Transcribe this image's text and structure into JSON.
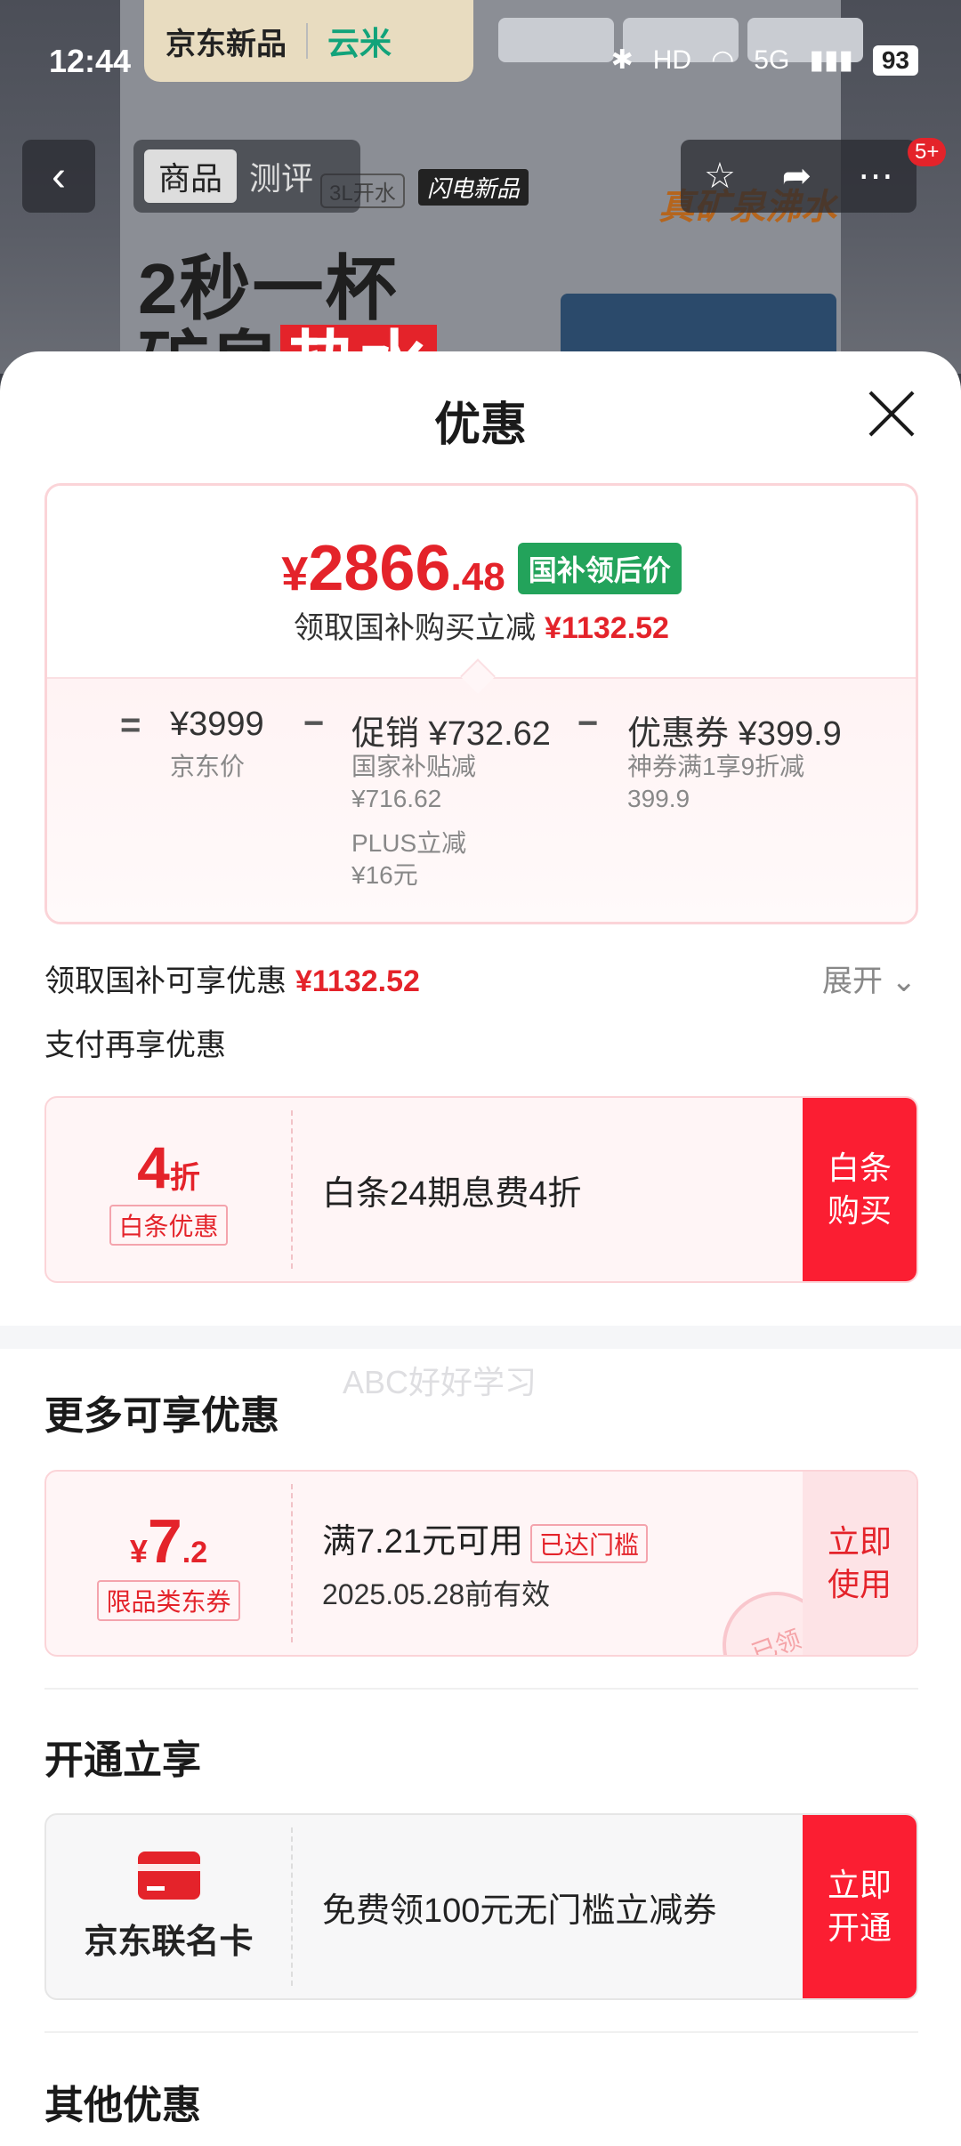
{
  "status_bar": {
    "time": "12:44",
    "battery": "93",
    "network": "5G"
  },
  "background": {
    "brand_jd": "京东新品",
    "brand_yunmi": "云米",
    "headline1": "2秒一杯",
    "headline2_a": "矿泉",
    "headline2_b": "热水",
    "sub_tag": "3L开水",
    "flash_tag": "闪电新品",
    "badge": "真矿泉沸水"
  },
  "nav": {
    "tab_product": "商品",
    "tab_review": "测评",
    "badge": "5+"
  },
  "sheet": {
    "title": "优惠",
    "summary": {
      "price_symbol": "¥",
      "price_int": "2866",
      "price_dec": ".48",
      "price_tag": "国补领后价",
      "save_text": "领取国补购买立减",
      "save_amount": "¥1132.52",
      "calc": {
        "eq": "=",
        "jd_price": "¥3999",
        "jd_price_label": "京东价",
        "minus1": "−",
        "promo": "促销 ¥732.62",
        "promo_sub1": "国家补贴减",
        "promo_sub1_val": "¥716.62",
        "promo_sub2": "PLUS立减",
        "promo_sub2_val": "¥16元",
        "minus2": "−",
        "coupon": "优惠券 ¥399.9",
        "coupon_sub": "神券满1享9折减",
        "coupon_sub_val": "399.9"
      }
    },
    "gov_row": {
      "label": "领取国补可享优惠",
      "amount": "¥1132.52",
      "expand": "展开"
    },
    "pay_row": {
      "label": "支付再享优惠"
    },
    "watermark": "ABC好好学习",
    "baitiao": {
      "discount_num": "4",
      "discount_unit": "折",
      "tag": "白条优惠",
      "main": "白条24期息费4折",
      "action_line1": "白条",
      "action_line2": "购买"
    },
    "more_section": "更多可享优惠",
    "coupon": {
      "symbol": "¥",
      "amount_int": "7",
      "amount_dec": ".2",
      "tag": "限品类东券",
      "main": "满7.21元可用",
      "reached": "已达门槛",
      "valid": "2025.05.28前有效",
      "stamp": "已领",
      "action_line1": "立即",
      "action_line2": "使用"
    },
    "open_section": "开通立享",
    "card": {
      "name": "京东联名卡",
      "main": "免费领100元无门槛立减券",
      "action_line1": "立即",
      "action_line2": "开通"
    },
    "other_section": "其他优惠"
  },
  "colors": {
    "accent_red": "#e4232a",
    "tag_green": "#23a35b",
    "button_red": "#fb1e32"
  }
}
